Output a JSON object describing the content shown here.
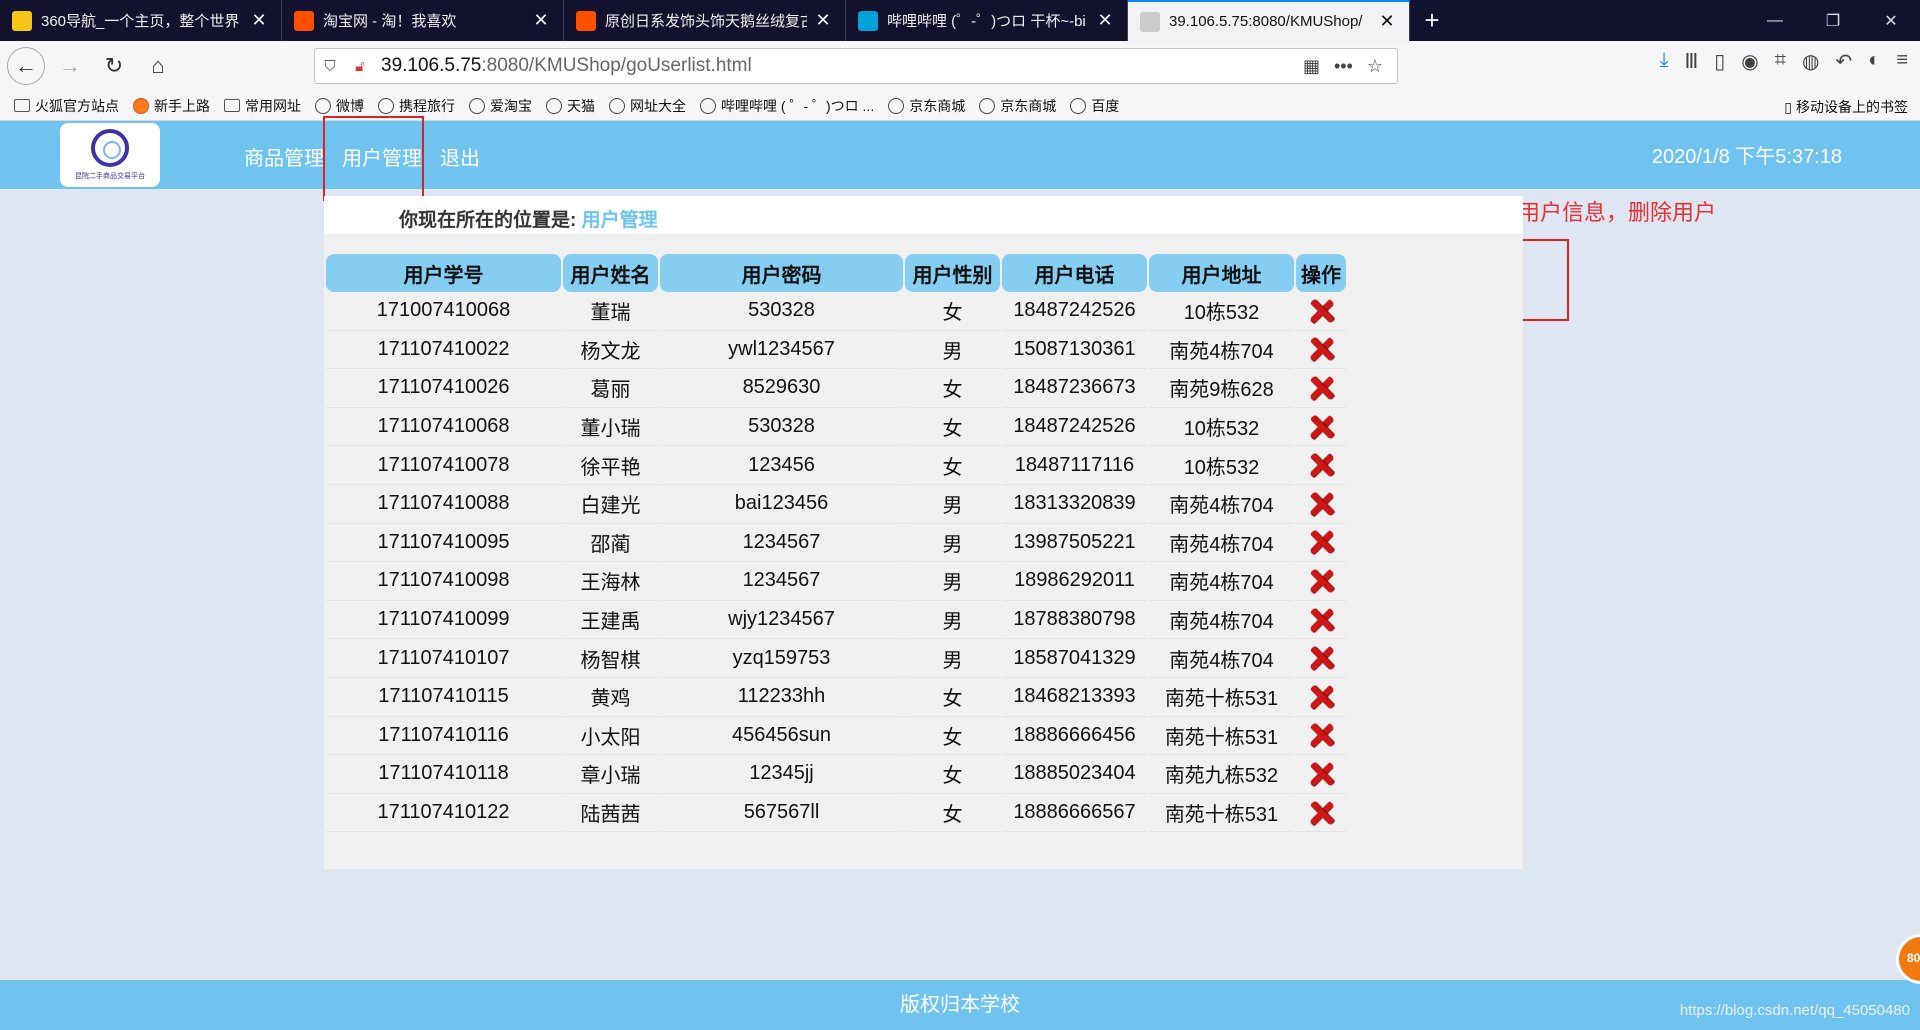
{
  "browser": {
    "tabs": [
      {
        "title": "360导航_一个主页，整个世界",
        "favicon": "360-icon",
        "color": "#f5c518"
      },
      {
        "title": "淘宝网 - 淘！我喜欢",
        "favicon": "taobao-icon",
        "color": "#ff5000"
      },
      {
        "title": "原创日系发饰头饰天鹅丝绒复古",
        "favicon": "taobao-icon",
        "color": "#ff5000"
      },
      {
        "title": "哔哩哔哩 (゜-゜)つロ 干杯~-bi",
        "favicon": "bilibili-icon",
        "color": "#00a1d6"
      },
      {
        "title": "39.106.5.75:8080/KMUShop/",
        "favicon": "page-icon",
        "color": "#cccccc"
      }
    ],
    "new_tab": "+",
    "window_controls": [
      "—",
      "❐",
      "✕"
    ],
    "url_host": "39.106.5.75",
    "url_rest": ":8080/KMUShop/goUserlist.html",
    "bookmarks": [
      {
        "label": "火狐官方站点",
        "icon": "folder"
      },
      {
        "label": "新手上路",
        "icon": "fox"
      },
      {
        "label": "常用网址",
        "icon": "folder"
      },
      {
        "label": "微博",
        "icon": "globe"
      },
      {
        "label": "携程旅行",
        "icon": "globe"
      },
      {
        "label": "爱淘宝",
        "icon": "globe"
      },
      {
        "label": "天猫",
        "icon": "globe"
      },
      {
        "label": "网址大全",
        "icon": "globe"
      },
      {
        "label": "哔哩哔哩 ( ゜- ゜)つロ ...",
        "icon": "globe"
      },
      {
        "label": "京东商城",
        "icon": "globe"
      },
      {
        "label": "京东商城",
        "icon": "globe"
      },
      {
        "label": "百度",
        "icon": "globe"
      }
    ],
    "mobile_bookmarks": "移动设备上的书签"
  },
  "header": {
    "logo_text": "昆院二手商品交易平台",
    "menu": [
      "商品管理",
      "用户管理",
      "退出"
    ],
    "datetime": "2020/1/8 下午5:37:18"
  },
  "annotation": "查看用户信息，删除用户",
  "breadcrumb": {
    "prefix": "你现在所在的位置是:",
    "current": "用户管理"
  },
  "table": {
    "columns": [
      "用户学号",
      "用户姓名",
      "用户密码",
      "用户性别",
      "用户电话",
      "用户地址",
      "操作"
    ],
    "rows": [
      [
        "171007410068",
        "董瑞",
        "530328",
        "女",
        "18487242526",
        "10栋532"
      ],
      [
        "171107410022",
        "杨文龙",
        "ywl1234567",
        "男",
        "15087130361",
        "南苑4栋704"
      ],
      [
        "171107410026",
        "葛丽",
        "8529630",
        "女",
        "18487236673",
        "南苑9栋628"
      ],
      [
        "171107410068",
        "董小瑞",
        "530328",
        "女",
        "18487242526",
        "10栋532"
      ],
      [
        "171107410078",
        "徐平艳",
        "123456",
        "女",
        "18487117116",
        "10栋532"
      ],
      [
        "171107410088",
        "白建光",
        "bai123456",
        "男",
        "18313320839",
        "南苑4栋704"
      ],
      [
        "171107410095",
        "邵蔺",
        "1234567",
        "男",
        "13987505221",
        "南苑4栋704"
      ],
      [
        "171107410098",
        "王海林",
        "1234567",
        "男",
        "18986292011",
        "南苑4栋704"
      ],
      [
        "171107410099",
        "王建禹",
        "wjy1234567",
        "男",
        "18788380798",
        "南苑4栋704"
      ],
      [
        "171107410107",
        "杨智棋",
        "yzq159753",
        "男",
        "18587041329",
        "南苑4栋704"
      ],
      [
        "171107410115",
        "黄鸡",
        "112233hh",
        "女",
        "18468213393",
        "南苑十栋531"
      ],
      [
        "171107410116",
        "小太阳",
        "456456sun",
        "女",
        "18886666456",
        "南苑十栋531"
      ],
      [
        "171107410118",
        "章小瑞",
        "12345jj",
        "女",
        "18885023404",
        "南苑九栋532"
      ],
      [
        "171107410122",
        "陆茜茜",
        "567567ll",
        "女",
        "18886666567",
        "南苑十栋531"
      ]
    ]
  },
  "footer": "版权归本学校",
  "watermark": "https://blog.csdn.net/qq_45050480",
  "float_badge": "80"
}
